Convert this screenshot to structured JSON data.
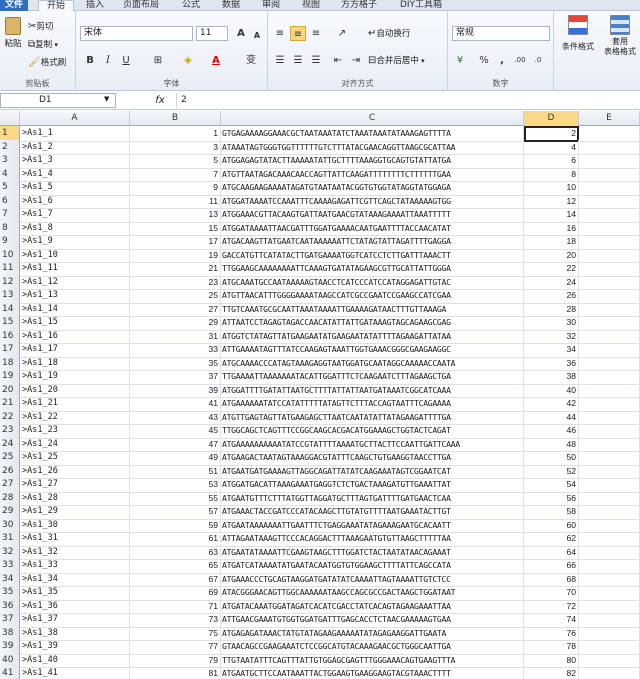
{
  "tabs": [
    "文件",
    "开始",
    "插入",
    "页面布局",
    "公式",
    "数据",
    "审阅",
    "视图",
    "方方格子",
    "DIY工具箱"
  ],
  "clipboard": {
    "paste": "粘贴",
    "cut": "剪切",
    "copy": "复制",
    "format_painter": "格式刷",
    "label": "剪贴板"
  },
  "font": {
    "name": "宋体",
    "size": "11",
    "bold": "B",
    "italic": "I",
    "underline": "U",
    "label": "字体",
    "grow": "A",
    "shrink": "A",
    "wen": "变"
  },
  "alignment": {
    "wrap": "自动换行",
    "merge": "合并后居中",
    "label": "对齐方式"
  },
  "number": {
    "format": "常规",
    "percent": "%",
    "comma": ",",
    "label": "数字"
  },
  "styles": {
    "conditional": "条件格式",
    "table": "套用\n表格格式"
  },
  "formula_bar": {
    "name_box": "D1",
    "fx": "fx",
    "content": "2"
  },
  "columns": [
    "A",
    "B",
    "C",
    "D",
    "E"
  ],
  "rows": [
    {
      "n": "1",
      "a": ">As1_1",
      "b": "1",
      "c": "GTGAGAAAAGGAAACGCTAATAAATATCTAAATAAATATAAAGAGTTTTA",
      "d": "2"
    },
    {
      "n": "2",
      "a": ">As1_2",
      "b": "3",
      "c": "ATAAATAGTGGGTGGTTTTTTGTCTTTATACGAACAGGTTAAGCGCATTAA",
      "d": "4"
    },
    {
      "n": "3",
      "a": ">As1_3",
      "b": "5",
      "c": "ATGGAGAGTATACTTAAAAATATTGCTTTTAAAGGTGCAGTGTATTATGA",
      "d": "6"
    },
    {
      "n": "4",
      "a": ">As1_4",
      "b": "7",
      "c": "ATGTTAATAGACAAACAACCAGTTATTCAAGATTTTTTTTCTTTTTTGAA",
      "d": "8"
    },
    {
      "n": "5",
      "a": ">As1_5",
      "b": "9",
      "c": "ATGCAAGAAGAAAATAGATGTAATAATACGGTGTGGTATAGGTATGGAGA",
      "d": "10"
    },
    {
      "n": "6",
      "a": ">As1_6",
      "b": "11",
      "c": "ATGGATAAAATCCAAATTTCAAAAGAGATTCGTTCAGCTATAAAAAGTGG",
      "d": "12"
    },
    {
      "n": "7",
      "a": ">As1_7",
      "b": "13",
      "c": "ATGGAAACGTTACAAGTGATTAATGAACGTATAAAGAAAATTAAATTTTT",
      "d": "14"
    },
    {
      "n": "8",
      "a": ">As1_8",
      "b": "15",
      "c": "ATGGATAAAATTAACGATTTGGATGAAAACAATGAATTTTACCAACATAT",
      "d": "16"
    },
    {
      "n": "9",
      "a": ">As1_9",
      "b": "17",
      "c": "ATGACAAGTTATGAATCAATAAAAAATTCTATAGTATTAGATTTTGAGGA",
      "d": "18"
    },
    {
      "n": "10",
      "a": ">As1_10",
      "b": "19",
      "c": "GACCATGTTCATATACTTGATGAAAATGGTCATCCTCTTGATTTAAACTT",
      "d": "20"
    },
    {
      "n": "11",
      "a": ">As1_11",
      "b": "21",
      "c": "TTGGAAGCAAAAAAAATTCAAAGTGATATAGAAGCGTTGCATTATTGGGA",
      "d": "22"
    },
    {
      "n": "12",
      "a": ">As1_12",
      "b": "23",
      "c": "ATGCAAATGCCAATAAAAAGTAACCTCATCCCATCCATAGGAGATTGTAC",
      "d": "24"
    },
    {
      "n": "13",
      "a": ">As1_13",
      "b": "25",
      "c": "ATGTTAACATTTGGGGAAAATAAGCCATCGCCGAATCCGAAGCCATCGAA",
      "d": "26"
    },
    {
      "n": "14",
      "a": ">As1_14",
      "b": "27",
      "c": "TTGTCAAATGCGCAATTAAATAAAATTGAAAAGATAACTTTGTTAAAGA",
      "d": "28"
    },
    {
      "n": "15",
      "a": ">As1_15",
      "b": "29",
      "c": "ATTAATCCTAGAGTAGACCAACATATTATTGATAAAGTAGCAGAAGCGAG",
      "d": "30"
    },
    {
      "n": "16",
      "a": ">As1_16",
      "b": "31",
      "c": "ATGGTCTATAGTTATGAAGAATATGAAGAATATATTTTAGAAGATTATAA",
      "d": "32"
    },
    {
      "n": "17",
      "a": ">As1_17",
      "b": "33",
      "c": "ATTGAAAATAGTTTATCCAAGAGTAAATTGGTGAAACGGGCGAAGAAGGC",
      "d": "34"
    },
    {
      "n": "18",
      "a": ">As1_18",
      "b": "35",
      "c": "ATGCAAAACCCATAGTAAAGAGGTAATGGATGCAATAGGCAAAAACCAATA",
      "d": "36"
    },
    {
      "n": "19",
      "a": ">As1_19",
      "b": "37",
      "c": "TTGAAAATTAAAAAAATACATTGGATTTCTCAAGAATCTTTAGAAGCTGA",
      "d": "38"
    },
    {
      "n": "20",
      "a": ">As1_20",
      "b": "39",
      "c": "ATGGATTTTGATATTAATGCTTTTATTATTAATGATAAATCGGCATCAAA",
      "d": "40"
    },
    {
      "n": "21",
      "a": ">As1_21",
      "b": "41",
      "c": "ATGAAAAAATATCCATATTTTTATAGTTCTTTACCAGTAATTTCAGAAAA",
      "d": "42"
    },
    {
      "n": "22",
      "a": ">As1_22",
      "b": "43",
      "c": "ATGTTGAGTAGTTATGAAGAGCTTAATCAATATATTATAGAAGATTTTGA",
      "d": "44"
    },
    {
      "n": "23",
      "a": ">As1_23",
      "b": "45",
      "c": "TTGGCAGCTCAGTTTCCGGCAAGCACGACATGGAAAGCTGGTACTCAGAT",
      "d": "46"
    },
    {
      "n": "24",
      "a": ">As1_24",
      "b": "47",
      "c": "ATGAAAAAAAAAATATCCGTATTTTAAAATGCTTACTTCCAATTGATTCAAA",
      "d": "48"
    },
    {
      "n": "25",
      "a": ">As1_25",
      "b": "49",
      "c": "ATGAAGACTAATAGTAAAGGACGTATTTCAAGCTGTGAAGGTAACCTTGA",
      "d": "50"
    },
    {
      "n": "26",
      "a": ">As1_26",
      "b": "51",
      "c": "ATGAATGATGAAAAGTTAGGCAGATTATATCAAGAAATAGTCGGAATCAT",
      "d": "52"
    },
    {
      "n": "27",
      "a": ">As1_27",
      "b": "53",
      "c": "ATGGATGACATTAAAGAAATGAGGTCTCTGACTAAAGATGTTGAAATTAT",
      "d": "54"
    },
    {
      "n": "28",
      "a": ">As1_28",
      "b": "55",
      "c": "ATGAATGTTTCTTTATGGTTAGGATGCTTTAGTGATTTTGATGAACTCAA",
      "d": "56"
    },
    {
      "n": "29",
      "a": ">As1_29",
      "b": "57",
      "c": "ATGAAACTACCGATCCCATACAAGCTTGTATGTTTTAATGAAATACTTGT",
      "d": "58"
    },
    {
      "n": "30",
      "a": ">As1_30",
      "b": "59",
      "c": "ATGAATAAAAAAATTGAATTTCTGAGGAAATATAGAAAGAATGCACAATT",
      "d": "60"
    },
    {
      "n": "31",
      "a": ">As1_31",
      "b": "61",
      "c": "ATTAGAATAAAGTTCCCACAGGACTTTAAAGAATGTGTTAAGCTTTTTAA",
      "d": "62"
    },
    {
      "n": "32",
      "a": ">As1_32",
      "b": "63",
      "c": "ATGAATATAAAATTCGAAGTAAGCTTTGGATCTACTAATATAACAGAAAT",
      "d": "64"
    },
    {
      "n": "33",
      "a": ">As1_33",
      "b": "65",
      "c": "ATGATCATAAAATATGAATACAATGGTGTGGAAGCTTTTATTCAGCCATA",
      "d": "66"
    },
    {
      "n": "34",
      "a": ">As1_34",
      "b": "67",
      "c": "ATGAAACCCTGCAGTAAGGATGATATATCAAAATTAGTAAAATTGTCTCC",
      "d": "68"
    },
    {
      "n": "35",
      "a": ">As1_35",
      "b": "69",
      "c": "ATACGGGAACAGTTGGCAAAAAATAAGCCAGCGCCGACTAAGCTGGATAAT",
      "d": "70"
    },
    {
      "n": "36",
      "a": ">As1_36",
      "b": "71",
      "c": "ATGATACAAATGGATAGATCACATCGACCTATCACAGTAGAAGAAATTAA",
      "d": "72"
    },
    {
      "n": "37",
      "a": ">As1_37",
      "b": "73",
      "c": "ATTGAACGAAATGTGGTGGATGATTTGAGCACCTCTAACGAAAAAGTGAA",
      "d": "74"
    },
    {
      "n": "38",
      "a": ">As1_38",
      "b": "75",
      "c": "ATGAGAGATAAACTATGTATAGAAGAAAAATATAGAGAAGGATTGAATA",
      "d": "76"
    },
    {
      "n": "39",
      "a": ">As1_39",
      "b": "77",
      "c": "GTAACAGCCGAAGAAATCTCCGGCATGTACAAAGAACGCTGGGCAATTGA",
      "d": "78"
    },
    {
      "n": "40",
      "a": ">As1_40",
      "b": "79",
      "c": "TTGTAATATTTCAGTTTATTGTGGAGCGAGTTTGGGAAACAGTGAAGTTTA",
      "d": "80"
    },
    {
      "n": "41",
      "a": ">As1_41",
      "b": "81",
      "c": "ATGAATGCTTCCAATAAATTACTGGAAGTGAAGGAAGTACGTAAACTTTT",
      "d": "82"
    }
  ]
}
